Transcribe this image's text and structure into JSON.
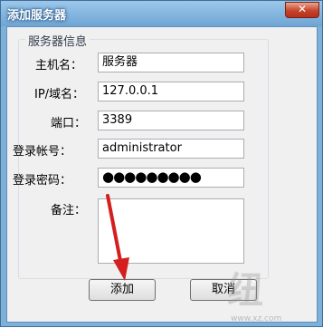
{
  "window": {
    "title": "添加服务器",
    "close_glyph": "✕"
  },
  "group": {
    "title": "服务器信息"
  },
  "fields": {
    "host_label": "主机名：",
    "host_value": "服务器",
    "ip_label": "IP/域名：",
    "ip_value": "127.0.0.1",
    "port_label": "端口：",
    "port_value": "3389",
    "account_label": "登录帐号：",
    "account_value": "administrator",
    "password_label": "登录密码：",
    "password_value": "●●●●●●●●●",
    "note_label": "备注：",
    "note_value": ""
  },
  "buttons": {
    "add": "添加",
    "cancel": "取消"
  },
  "watermark": {
    "logo": "纽",
    "url": "www.xz.com"
  },
  "colors": {
    "title_bar": "#6fa5d4",
    "annotation_arrow": "#d41f1f"
  }
}
